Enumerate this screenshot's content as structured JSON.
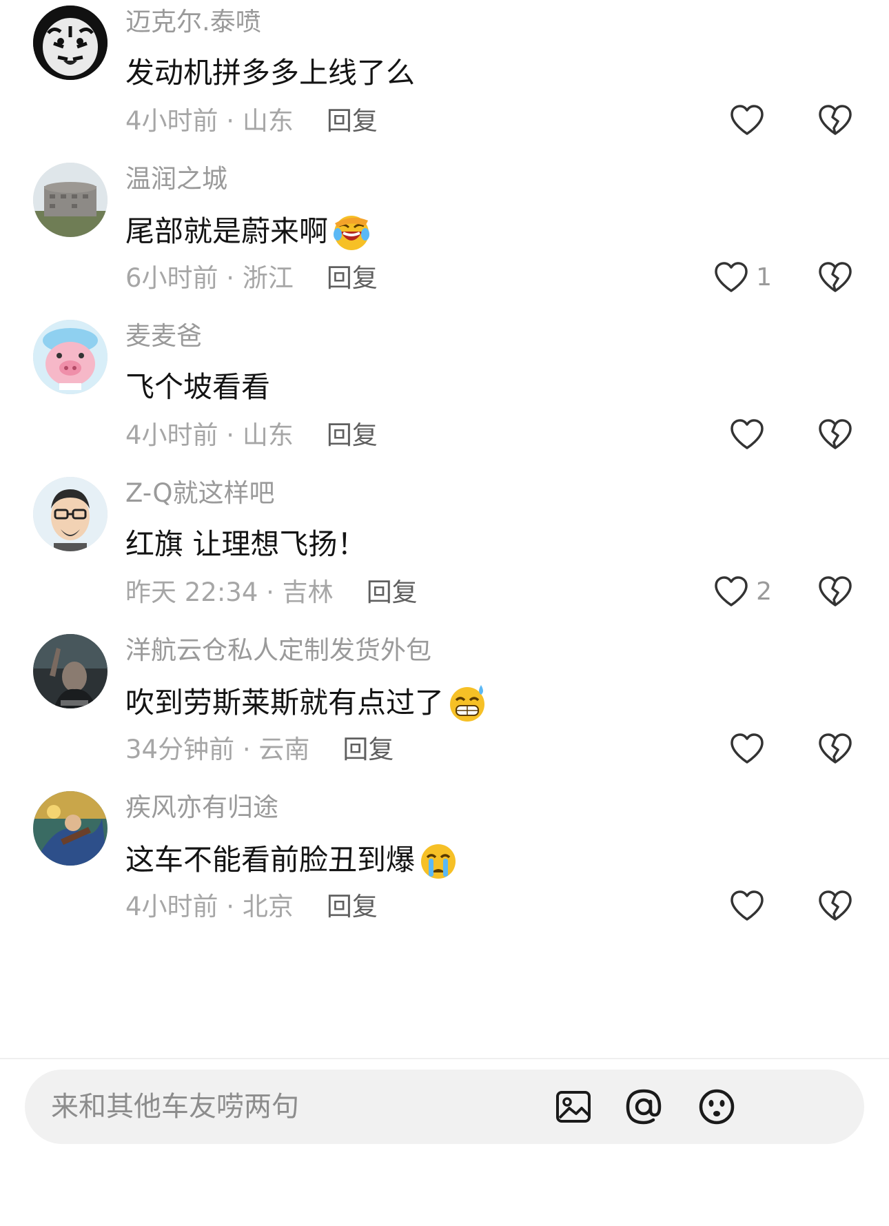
{
  "comments": [
    {
      "username": "迈克尔.泰喷",
      "text": "发动机拼多多上线了么",
      "emoji": "",
      "time": "4小时前 · 山东",
      "reply_label": "回复",
      "likes": "",
      "avatar": "tiger-avatar"
    },
    {
      "username": "温润之城",
      "text": "尾部就是蔚来啊",
      "emoji": "laughing-tears-emoji",
      "time": "6小时前 · 浙江",
      "reply_label": "回复",
      "likes": "1",
      "avatar": "building-avatar"
    },
    {
      "username": "麦麦爸",
      "text": "飞个坡看看",
      "emoji": "",
      "time": "4小时前 · 山东",
      "reply_label": "回复",
      "likes": "",
      "avatar": "pig-avatar"
    },
    {
      "username": "Z-Q就这样吧",
      "text": "红旗 让理想飞扬！",
      "emoji": "",
      "time": "昨天 22:34 · 吉林",
      "reply_label": "回复",
      "likes": "2",
      "avatar": "man-glasses-avatar"
    },
    {
      "username": "洋航云仓私人定制发货外包",
      "text": "吹到劳斯莱斯就有点过了",
      "emoji": "grin-sweat-emoji",
      "time": "34分钟前 · 云南",
      "reply_label": "回复",
      "likes": "",
      "avatar": "dark-photo-avatar"
    },
    {
      "username": "疾风亦有归途",
      "text": "这车不能看前脸丑到爆",
      "emoji": "crying-emoji",
      "time": "4小时前 · 北京",
      "reply_label": "回复",
      "likes": "",
      "avatar": "game-hero-avatar"
    }
  ],
  "composer": {
    "placeholder": "来和其他车友唠两句",
    "icons": [
      "image-icon",
      "at-icon",
      "emoji-icon"
    ]
  },
  "colors": {
    "username": "#9a9a9a",
    "text": "#141414",
    "meta": "#a6a6a6",
    "reply": "#5f5f5f",
    "composer_bg": "#f1f1f1"
  }
}
